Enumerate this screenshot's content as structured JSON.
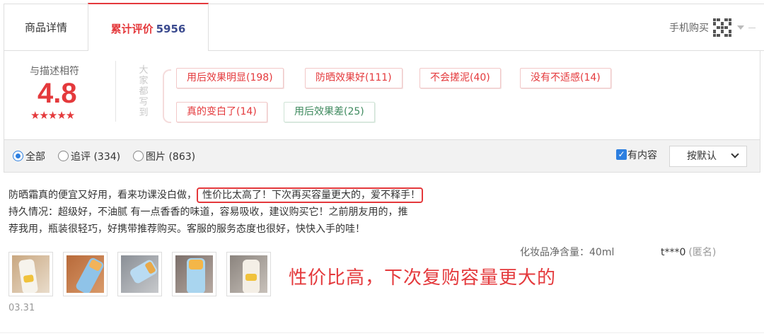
{
  "tabs": {
    "detail_label": "商品详情",
    "reviews_label": "累计评价",
    "reviews_count": "5956",
    "mobile_buy_label": "手机购买"
  },
  "summary": {
    "rating_label": "与描述相符",
    "rating_score": "4.8",
    "stars": "★★★★★",
    "side_label": "大家都写到",
    "tags": [
      {
        "text": "用后效果明显(198)",
        "sentiment": "positive"
      },
      {
        "text": "防晒效果好(111)",
        "sentiment": "positive"
      },
      {
        "text": "不会搓泥(40)",
        "sentiment": "positive"
      },
      {
        "text": "没有不适感(14)",
        "sentiment": "positive"
      },
      {
        "text": "真的变白了(14)",
        "sentiment": "positive"
      },
      {
        "text": "用后效果差(25)",
        "sentiment": "negative"
      }
    ]
  },
  "filters": {
    "all": "全部",
    "followup": "追评 (334)",
    "images": "图片 (863)",
    "has_content": "有内容",
    "sort": "按默认"
  },
  "review": {
    "line1_before": "防晒霜真的便宜又好用，看来功课没白做，",
    "line1_highlight": "性价比太高了！下次再买容量更大的，爱不释手！",
    "line2": "持久情况：超级好，不油腻 有一点香香的味道，容易吸收，建议购买它！之前朋友用的，推",
    "line3": "荐我用，瓶装很轻巧，好携带推荐购买。客服的服务态度也很好，快快入手的哇！",
    "spec": "化妆品净含量：40ml",
    "user": "t***0",
    "anon": "(匿名)",
    "date": "03.31",
    "annotation": "性价比高，下次复购容量更大的"
  },
  "colors": {
    "accent": "#e4393c",
    "count_blue": "#3c4b8f",
    "negative_tag": "#3e8a5e",
    "radio_blue": "#2d7fe0"
  }
}
